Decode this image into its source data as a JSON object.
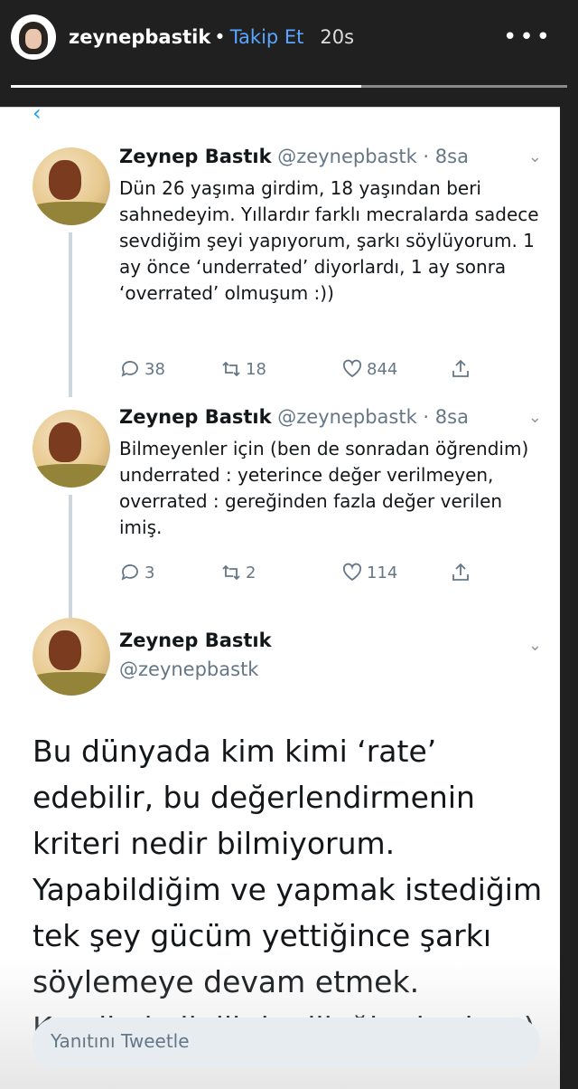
{
  "story": {
    "username": "zeynepbastik",
    "separator": "•",
    "follow_label": "Takip Et",
    "time": "20s",
    "more_icon": "more-dots-icon",
    "progress_fraction": 0.63
  },
  "tweets": [
    {
      "name": "Zeynep Bastık",
      "handle": "@zeynepbastk",
      "time": "· 8sa",
      "text": "Dün 26 yaşıma girdim, 18 yaşından beri sahnedeyim. Yıllardır farklı mecralarda sadece sevdiğim şeyi yapıyorum, şarkı söylüyorum. 1 ay önce ‘underrated’ diyorlardı, 1 ay sonra ‘overrated’ olmuşum :))",
      "replies": "38",
      "retweets": "18",
      "likes": "844"
    },
    {
      "name": "Zeynep Bastık",
      "handle": "@zeynepbastk",
      "time": "· 8sa",
      "text": "Bilmeyenler için (ben de sonradan öğrendim) underrated : yeterince değer verilmeyen, overrated : gereğinden fazla değer verilen imiş.",
      "replies": "3",
      "retweets": "2",
      "likes": "114"
    }
  ],
  "main_tweet": {
    "name": "Zeynep Bastık",
    "handle": "@zeynepbastk",
    "text": "Bu dünyada kim kimi ‘rate’ edebilir, bu değerlendirmenin kriteri nedir bilmiyorum. Yapabildiğim ve yapmak istediğim tek şey gücüm yettiğince şarkı söylemeye devam etmek. Kendimle ilgili de dileğim budur :)"
  },
  "reply_placeholder": "Yanıtını Tweetle",
  "colors": {
    "accent": "#1da1f2",
    "follow": "#58a6ff",
    "muted": "#657786"
  }
}
